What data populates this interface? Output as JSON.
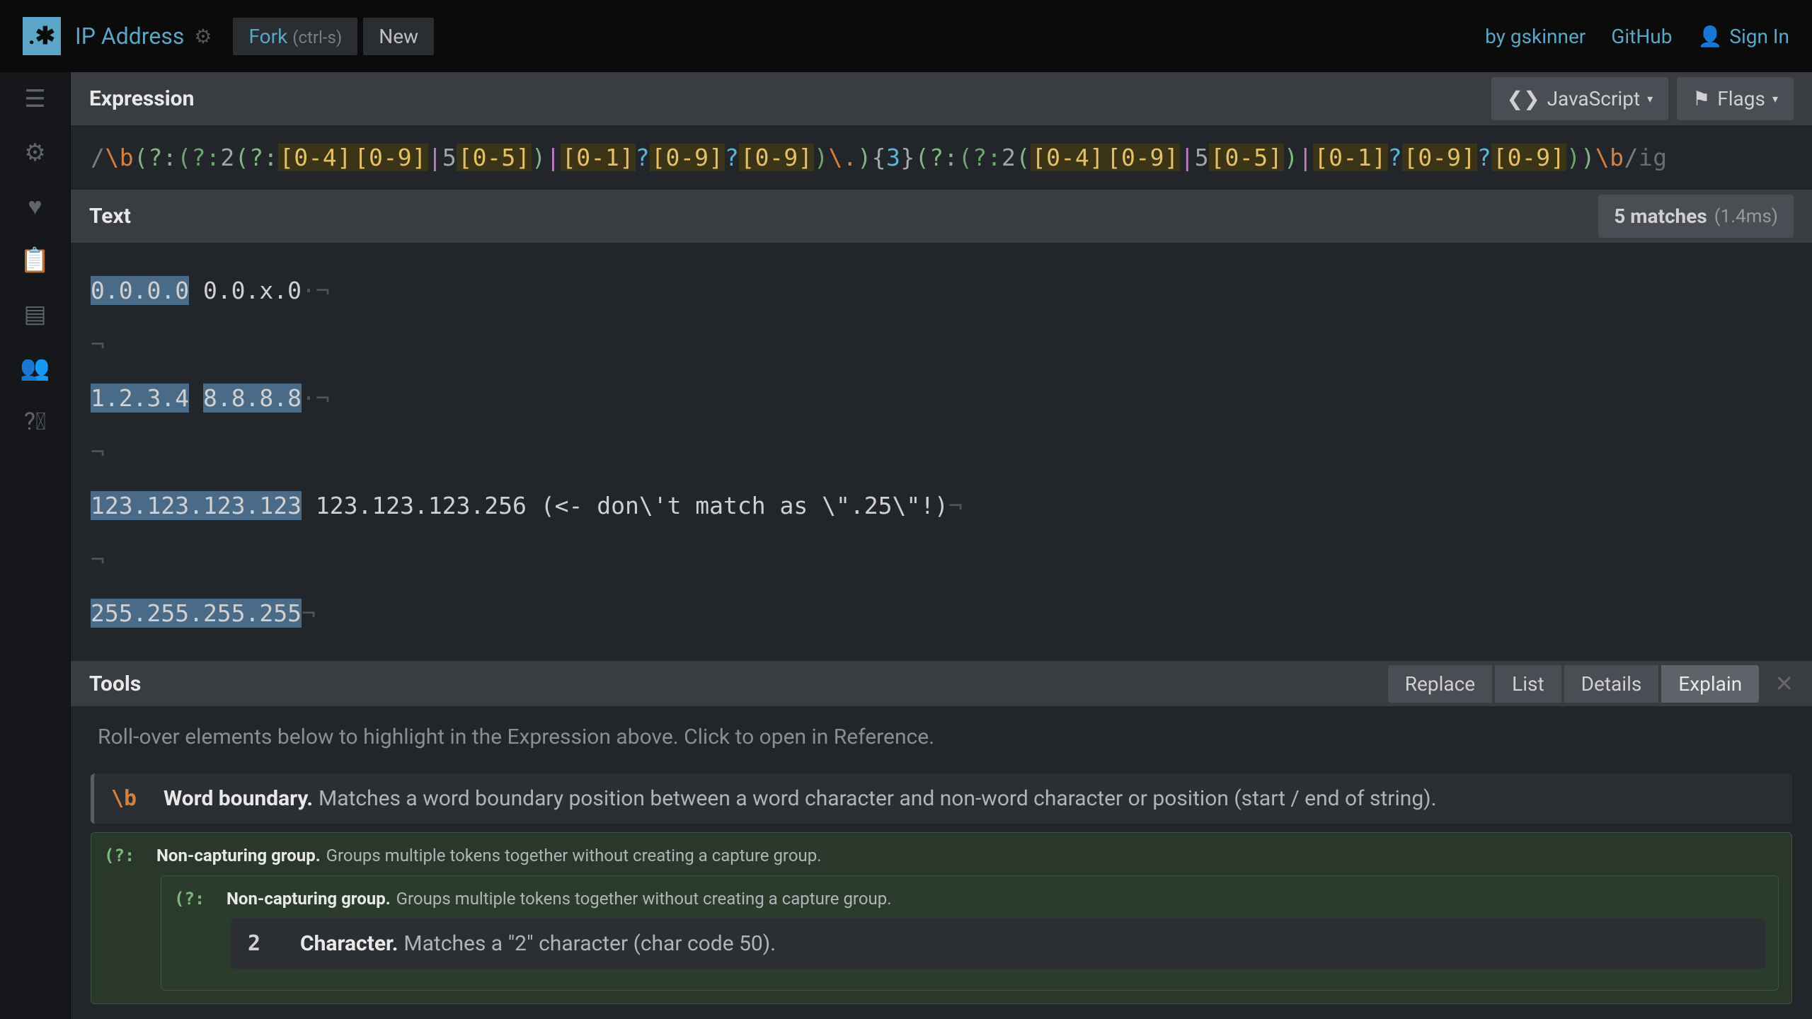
{
  "header": {
    "title": "IP Address",
    "fork_label": "Fork",
    "fork_hint": "(ctrl-s)",
    "new_label": "New",
    "author_prefix": "by ",
    "author": "gskinner",
    "github": "GitHub",
    "signin": "Sign In"
  },
  "expression_section": {
    "title": "Expression",
    "engine": "JavaScript",
    "flags_label": "Flags",
    "regex_open": "/",
    "regex_close": "/",
    "flags": "ig",
    "pattern": "\\b(?:(?:2(?:[0-4][0-9]|5[0-5])|[0-1]?[0-9]?[0-9])\\.){3}(?:(?:2([0-4][0-9]|5[0-5])|[0-1]?[0-9]?[0-9]))\\b"
  },
  "text_section": {
    "title": "Text",
    "match_count": "5 matches",
    "match_time": "(1.4ms)",
    "lines": [
      [
        {
          "t": "0.0.0.0",
          "m": true
        },
        {
          "t": " 0.0.x.0",
          "m": false
        },
        {
          "ws": "·¬"
        }
      ],
      [
        {
          "ws": "¬"
        }
      ],
      [
        {
          "t": "1.2.3.4",
          "m": true
        },
        {
          "t": " ",
          "m": false
        },
        {
          "t": "8.8.8.8",
          "m": true
        },
        {
          "ws": "·¬"
        }
      ],
      [
        {
          "ws": "¬"
        }
      ],
      [
        {
          "t": "123.123.123.123",
          "m": true
        },
        {
          "t": " 123.123.123.256 (<- don\\'t match as \\\".25\\\"!)",
          "m": false
        },
        {
          "ws": "¬"
        }
      ],
      [
        {
          "ws": "¬"
        }
      ],
      [
        {
          "t": "255.255.255.255",
          "m": true
        },
        {
          "ws": "¬"
        }
      ]
    ]
  },
  "tools": {
    "title": "Tools",
    "tabs": [
      "Replace",
      "List",
      "Details",
      "Explain"
    ],
    "active": "Explain",
    "hint": "Roll-over elements below to highlight in the Expression above. Click to open in Reference.",
    "rows": [
      {
        "token": "\\b",
        "label": "Word boundary.",
        "desc": "Matches a word boundary position between a word character and non-word character or position (start / end of string)."
      },
      {
        "token": "(?:",
        "label": "Non-capturing group.",
        "desc": "Groups multiple tokens together without creating a capture group."
      },
      {
        "token": "(?:",
        "label": "Non-capturing group.",
        "desc": "Groups multiple tokens together without creating a capture group."
      },
      {
        "token": "2",
        "label": "Character.",
        "desc": "Matches a \"2\" character (char code 50)."
      }
    ]
  }
}
